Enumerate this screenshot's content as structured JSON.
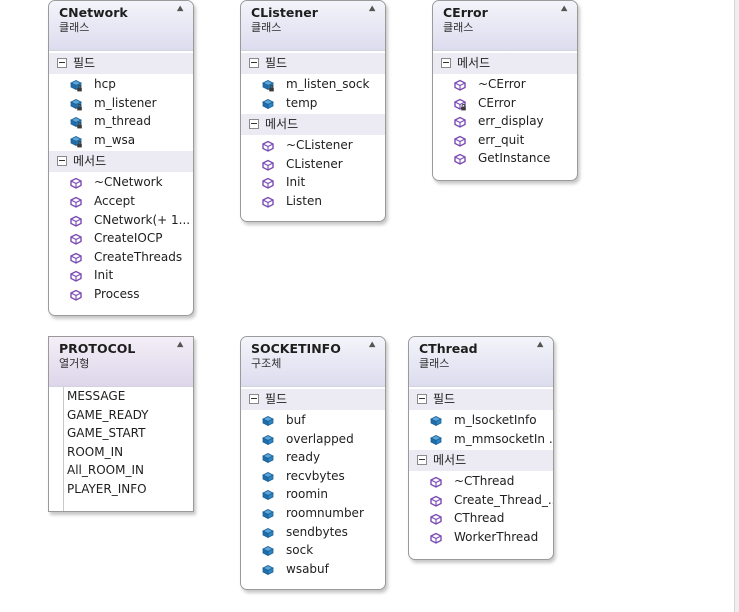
{
  "labels": {
    "fields": "필드",
    "methods": "메서드"
  },
  "collapse_glyph": "⯅",
  "icon_names": {
    "field-private": "private-field-icon",
    "field-public": "public-field-icon",
    "method-public": "public-method-icon",
    "method-private": "private-method-icon"
  },
  "colors": {
    "field": "#1f6fb0",
    "method": "#7b4bb3",
    "header": "#dcdcef",
    "enum_header": "#ded6ea"
  },
  "boxes": [
    {
      "id": "cnetwork",
      "name": "CNetwork",
      "kind": "클래스",
      "fields": [
        {
          "name": "hcp",
          "access": "private"
        },
        {
          "name": "m_listener",
          "access": "private"
        },
        {
          "name": "m_thread",
          "access": "private"
        },
        {
          "name": "m_wsa",
          "access": "private"
        }
      ],
      "methods": [
        {
          "name": "~CNetwork",
          "access": "public"
        },
        {
          "name": "Accept",
          "access": "public"
        },
        {
          "name": "CNetwork(+ 1...",
          "access": "public"
        },
        {
          "name": "CreateIOCP",
          "access": "public"
        },
        {
          "name": "CreateThreads",
          "access": "public"
        },
        {
          "name": "Init",
          "access": "public"
        },
        {
          "name": "Process",
          "access": "public"
        }
      ]
    },
    {
      "id": "clistener",
      "name": "CListener",
      "kind": "클래스",
      "fields": [
        {
          "name": "m_listen_sock",
          "access": "private"
        },
        {
          "name": "temp",
          "access": "public"
        }
      ],
      "methods": [
        {
          "name": "~CListener",
          "access": "public"
        },
        {
          "name": "CListener",
          "access": "public"
        },
        {
          "name": "Init",
          "access": "public"
        },
        {
          "name": "Listen",
          "access": "public"
        }
      ]
    },
    {
      "id": "cerror",
      "name": "CError",
      "kind": "클래스",
      "methods": [
        {
          "name": "~CError",
          "access": "public"
        },
        {
          "name": "CError",
          "access": "private"
        },
        {
          "name": "err_display",
          "access": "public"
        },
        {
          "name": "err_quit",
          "access": "public"
        },
        {
          "name": "GetInstance",
          "access": "public"
        }
      ]
    },
    {
      "id": "protocol",
      "name": "PROTOCOL",
      "kind": "열거형",
      "members": [
        "MESSAGE",
        "GAME_READY",
        "GAME_START",
        "ROOM_IN",
        "All_ROOM_IN",
        "PLAYER_INFO"
      ]
    },
    {
      "id": "socketinfo",
      "name": "SOCKETINFO",
      "kind": "구조체",
      "fields": [
        {
          "name": "buf",
          "access": "public"
        },
        {
          "name": "overlapped",
          "access": "public"
        },
        {
          "name": "ready",
          "access": "public"
        },
        {
          "name": "recvbytes",
          "access": "public"
        },
        {
          "name": "roomin",
          "access": "public"
        },
        {
          "name": "roomnumber",
          "access": "public"
        },
        {
          "name": "sendbytes",
          "access": "public"
        },
        {
          "name": "sock",
          "access": "public"
        },
        {
          "name": "wsabuf",
          "access": "public"
        }
      ]
    },
    {
      "id": "cthread",
      "name": "CThread",
      "kind": "클래스",
      "fields": [
        {
          "name": "m_lsocketInfo",
          "access": "public"
        },
        {
          "name": "m_mmsocketIn ...",
          "access": "public"
        }
      ],
      "methods": [
        {
          "name": "~CThread",
          "access": "public"
        },
        {
          "name": "Create_Thread_...",
          "access": "public"
        },
        {
          "name": "CThread",
          "access": "public"
        },
        {
          "name": "WorkerThread",
          "access": "public"
        }
      ]
    }
  ]
}
